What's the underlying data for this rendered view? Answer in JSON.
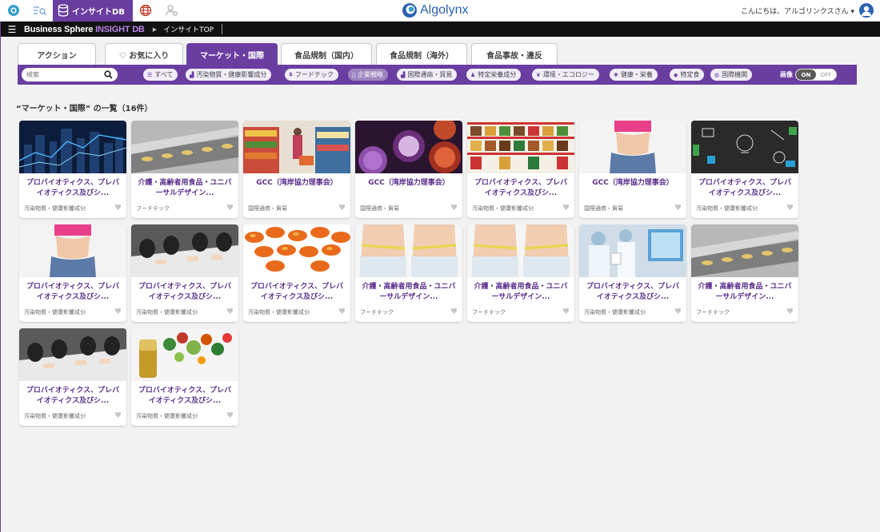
{
  "header": {
    "db_tab_label": "インサイトDB",
    "logo_text": "Algolynx",
    "greeting": "こんにちは、アルゴリンクスさん ▾"
  },
  "navbar": {
    "brand_main": "Business Sphere ",
    "brand_accent": "INSIGHT DB",
    "breadcrumb": "インサイトTOP"
  },
  "tabs": [
    {
      "label": "アクション",
      "active": false
    },
    {
      "label": "♡ お気に入り",
      "active": false
    },
    {
      "label": "マーケット・国際",
      "active": true
    },
    {
      "label": "食品規制（国内）",
      "active": false
    },
    {
      "label": "食品規制（海外）",
      "active": false
    },
    {
      "label": "食品事故・違反",
      "active": false
    }
  ],
  "search": {
    "placeholder": "検索"
  },
  "chips": [
    {
      "icon": "list-icon",
      "glyph": "☰",
      "label": "すべて",
      "active": false
    },
    {
      "icon": "chart-icon",
      "glyph": "▟",
      "label": "汚染物質・健康影響成分",
      "active": false
    },
    {
      "icon": "hourglass-icon",
      "glyph": "⧗",
      "label": "フードテック",
      "active": false
    },
    {
      "icon": "document-icon",
      "glyph": "▯",
      "label": "企業戦略",
      "active": true
    },
    {
      "icon": "trend-icon",
      "glyph": "▟",
      "label": "国際通商・貿易",
      "active": false
    },
    {
      "icon": "person-icon",
      "glyph": "♟",
      "label": "特定栄養成分",
      "active": false
    },
    {
      "icon": "leaf-icon",
      "glyph": "❦",
      "label": "環境・エコロジー",
      "active": false
    },
    {
      "icon": "health-icon",
      "glyph": "✚",
      "label": "健康・栄養",
      "active": false
    },
    {
      "icon": "tag-icon",
      "glyph": "◆",
      "label": "特定食",
      "active": false
    },
    {
      "icon": "globe-icon",
      "glyph": "◍",
      "label": "国際機関",
      "active": false
    }
  ],
  "image_toggle": {
    "label": "画像",
    "on": "ON",
    "off": "OFF"
  },
  "list_heading": "“マーケット・国際” の一覧（16件）",
  "cards": [
    {
      "title": "プロバイオティクス、プレバイオティクス及びシ...",
      "category": "汚染物質・健康影響成分",
      "thumb": "city-night"
    },
    {
      "title": "介護・高齢者用食品・ユニバーサルデザイン...",
      "category": "フードテック",
      "thumb": "production-line"
    },
    {
      "title": "GCC（湾岸協力理事会）",
      "category": "国際通商・貿易",
      "thumb": "supermarket"
    },
    {
      "title": "GCC（湾岸協力理事会）",
      "category": "国際通商・貿易",
      "thumb": "microbes"
    },
    {
      "title": "プロバイオティクス、プレバイオティクス及びシ...",
      "category": "汚染物質・健康影響成分",
      "thumb": "store-shelves"
    },
    {
      "title": "GCC（湾岸協力理事会）",
      "category": "国際通商・貿易",
      "thumb": "waist-pink"
    },
    {
      "title": "プロバイオティクス、プレバイオティクス及びシ...",
      "category": "汚染物質・健康影響成分",
      "thumb": "chalkboard"
    },
    {
      "title": "プロバイオティクス、プレバイオティクス及びシ...",
      "category": "汚染物質・健康影響成分",
      "thumb": "waist-pink"
    },
    {
      "title": "プロバイオティクス、プレバイオティクス及びシ...",
      "category": "汚染物質・健康影響成分",
      "thumb": "meeting"
    },
    {
      "title": "プロバイオティクス、プレバイオティクス及びシ...",
      "category": "汚染物質・健康影響成分",
      "thumb": "capsules"
    },
    {
      "title": "介護・高齢者用食品・ユニバーサルデザイン...",
      "category": "フードテック",
      "thumb": "measuring-waist"
    },
    {
      "title": "介護・高齢者用食品・ユニバーサルデザイン...",
      "category": "フードテック",
      "thumb": "measuring-waist"
    },
    {
      "title": "プロバイオティクス、プレバイオティクス及びシ...",
      "category": "汚染物質・健康影響成分",
      "thumb": "lab"
    },
    {
      "title": "介護・高齢者用食品・ユニバーサルデザイン...",
      "category": "フードテック",
      "thumb": "production-line"
    },
    {
      "title": "プロバイオティクス、プレバイオティクス及びシ...",
      "category": "汚染物質・健康影響成分",
      "thumb": "meeting"
    },
    {
      "title": "プロバイオティクス、プレバイオティクス及びシ...",
      "category": "汚染物質・健康影響成分",
      "thumb": "supplements"
    }
  ],
  "colors": {
    "brand_purple": "#6a3ea1",
    "title_purple": "#5a2f8a",
    "logo_blue": "#2a62b0"
  }
}
